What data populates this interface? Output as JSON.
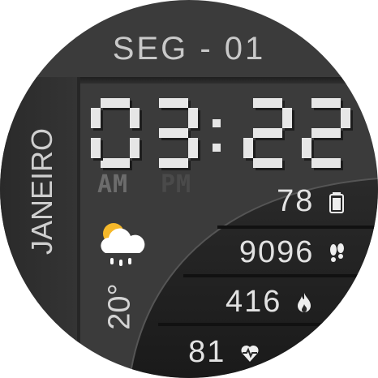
{
  "date": "SEG - 01",
  "month": "JANEIRO",
  "time": {
    "digits": "0322",
    "am": "AM",
    "pm": "PM"
  },
  "weather": {
    "icon": "cloud-sun-rain-icon",
    "temperature": "20°"
  },
  "stats": {
    "battery": {
      "value": "78",
      "icon": "battery-icon"
    },
    "steps": {
      "value": "9096",
      "icon": "footprints-icon"
    },
    "calories": {
      "value": "416",
      "icon": "flame-icon"
    },
    "heart_rate": {
      "value": "81",
      "icon": "heart-pulse-icon"
    }
  },
  "colors": {
    "background": "#3b3b3b",
    "panel": "#1e1e1e",
    "text": "#e2e2e2",
    "sun": "#f5b82a"
  }
}
